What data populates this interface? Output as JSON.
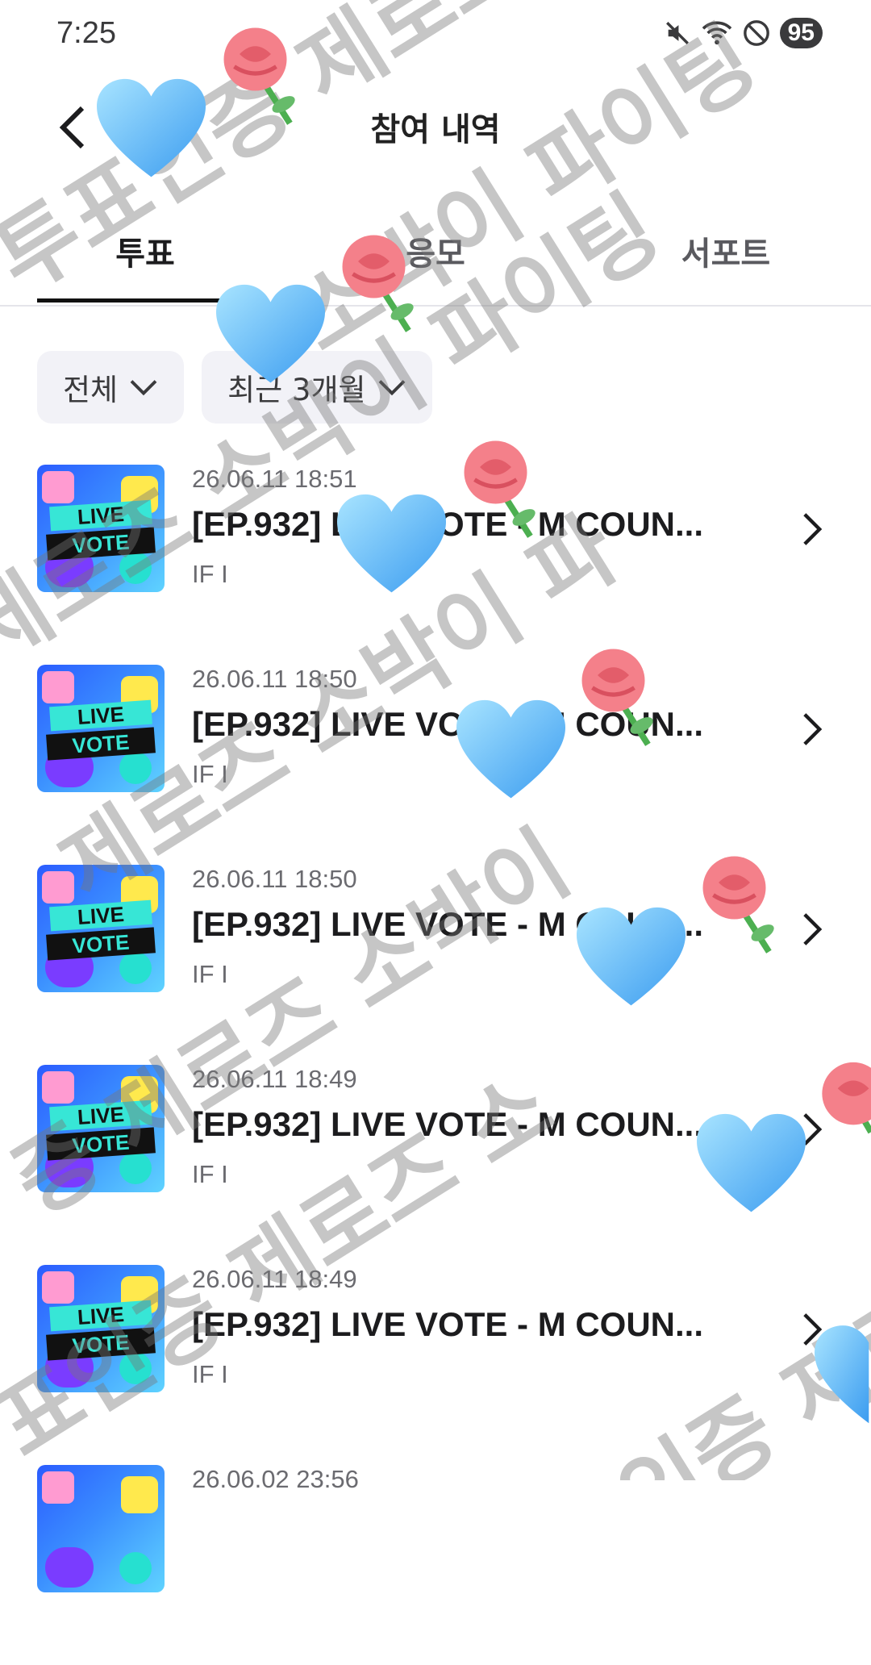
{
  "status": {
    "time": "7:25",
    "battery": "95"
  },
  "header": {
    "title": "참여 내역"
  },
  "tabs": [
    {
      "label": "투표",
      "active": true
    },
    {
      "label": "응모",
      "active": false
    },
    {
      "label": "서포트",
      "active": false
    }
  ],
  "filters": {
    "category": "전체",
    "period": "최근 3개월"
  },
  "items": [
    {
      "date": "26.06.11 18:51",
      "title": "[EP.932] LIVE VOTE - M COUN...",
      "sub": "IF I",
      "thumb_line1": "LIVE",
      "thumb_line2": "VOTE"
    },
    {
      "date": "26.06.11 18:50",
      "title": "[EP.932] LIVE VOTE - M COUN...",
      "sub": "IF I",
      "thumb_line1": "LIVE",
      "thumb_line2": "VOTE"
    },
    {
      "date": "26.06.11 18:50",
      "title": "[EP.932] LIVE VOTE - M COUN...",
      "sub": "IF I",
      "thumb_line1": "LIVE",
      "thumb_line2": "VOTE"
    },
    {
      "date": "26.06.11 18:49",
      "title": "[EP.932] LIVE VOTE - M COUN...",
      "sub": "IF I",
      "thumb_line1": "LIVE",
      "thumb_line2": "VOTE"
    },
    {
      "date": "26.06.11 18:49",
      "title": "[EP.932] LIVE VOTE - M COUN...",
      "sub": "IF I",
      "thumb_line1": "LIVE",
      "thumb_line2": "VOTE"
    },
    {
      "date": "26.06.02 23:56",
      "title": "",
      "sub": "",
      "thumb_line1": "",
      "thumb_line2": ""
    }
  ],
  "watermarks": [
    "소박이 파이팅",
    "제로즈 소박이 파이팅",
    "제로즈 소박이 파",
    "증 제로즈 소박이",
    "표인증 제로즈 소",
    "투표인증 제로즈",
    "기 투표인증 제로즈"
  ]
}
